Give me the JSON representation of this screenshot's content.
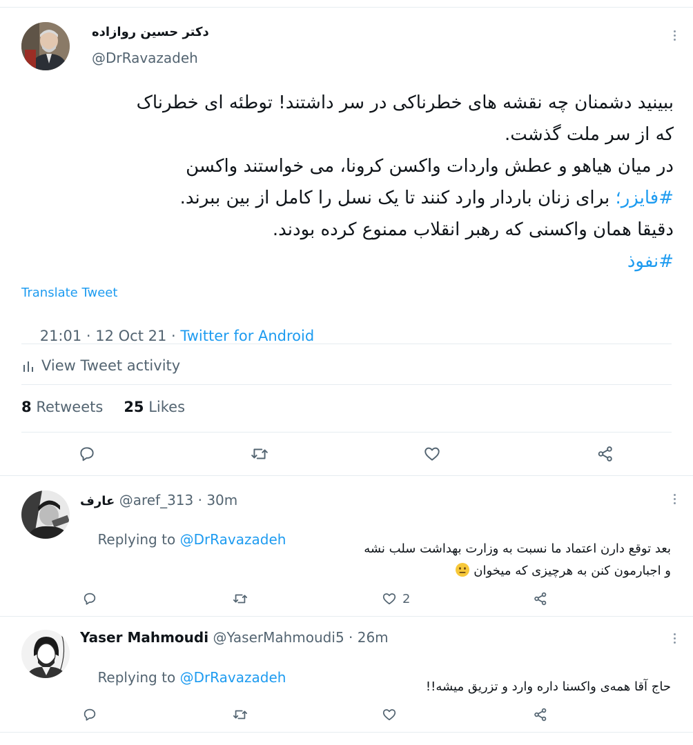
{
  "main_tweet": {
    "author_name": "دکتر حسین روازاده",
    "author_handle": "@DrRavazadeh",
    "text_lines": [
      "ببینید دشمنان چه نقشه های خطرناکی در سر داشتند! توطئه ای خطرناک",
      "که از سر ملت گذشت.",
      " در میان هیاهو و عطش واردات واکسن کرونا، می خواستند واکسن",
      "برای زنان باردار وارد کنند تا یک نسل را کامل از بین ببرند.",
      "دقیقا همان واکسنی که رهبر انقلاب ممنوع کرده بودند."
    ],
    "hashtag_pfizer": "#فایزر؛",
    "hashtag_nofooz": "#نفوذ",
    "translate_label": "Translate Tweet",
    "timestamp": "21:01 · 12 Oct 21 · ",
    "source": "Twitter for Android",
    "activity_label": "View Tweet activity",
    "retweets_count": "8",
    "retweets_label": "Retweets",
    "likes_count": "25",
    "likes_label": "Likes"
  },
  "replies": [
    {
      "author_name": "عارف",
      "handle_time": "@aref_313 · 30m",
      "replying_prefix": "Replying to ",
      "replying_handle": "@DrRavazadeh",
      "text_lines": [
        "بعد توقع دارن اعتماد ما نسبت به وزارت بهداشت سلب نشه",
        "و اجبارمون کنن به هرچیزی که میخوان"
      ],
      "emoji": "😐",
      "like_count": "2"
    },
    {
      "author_name": "Yaser Mahmoudi",
      "handle_time": "@YaserMahmoudi5 · 26m",
      "replying_prefix": "Replying to ",
      "replying_handle": "@DrRavazadeh",
      "text_lines": [
        "حاج آقا همه‌ی واکسنا داره وارد و تزریق میشه!!"
      ],
      "like_count": ""
    }
  ],
  "icons": {
    "reply": "reply-icon",
    "retweet": "retweet-icon",
    "like": "heart-icon",
    "share": "share-icon",
    "more": "more-icon",
    "activity": "bar-chart-icon"
  },
  "colors": {
    "accent": "#1d9bf0",
    "text": "#0f1419",
    "muted": "#536471",
    "divider": "#e6ecf0"
  }
}
